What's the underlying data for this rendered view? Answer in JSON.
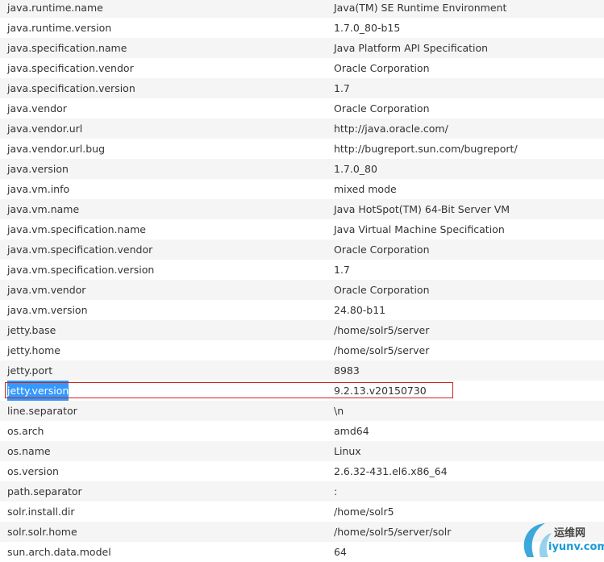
{
  "properties": [
    {
      "key": "java.runtime.name",
      "value": "Java(TM) SE Runtime Environment"
    },
    {
      "key": "java.runtime.version",
      "value": "1.7.0_80-b15"
    },
    {
      "key": "java.specification.name",
      "value": "Java Platform API Specification"
    },
    {
      "key": "java.specification.vendor",
      "value": "Oracle Corporation"
    },
    {
      "key": "java.specification.version",
      "value": "1.7"
    },
    {
      "key": "java.vendor",
      "value": "Oracle Corporation"
    },
    {
      "key": "java.vendor.url",
      "value": "http://java.oracle.com/"
    },
    {
      "key": "java.vendor.url.bug",
      "value": "http://bugreport.sun.com/bugreport/"
    },
    {
      "key": "java.version",
      "value": "1.7.0_80"
    },
    {
      "key": "java.vm.info",
      "value": "mixed mode"
    },
    {
      "key": "java.vm.name",
      "value": "Java HotSpot(TM) 64-Bit Server VM"
    },
    {
      "key": "java.vm.specification.name",
      "value": "Java Virtual Machine Specification"
    },
    {
      "key": "java.vm.specification.vendor",
      "value": "Oracle Corporation"
    },
    {
      "key": "java.vm.specification.version",
      "value": "1.7"
    },
    {
      "key": "java.vm.vendor",
      "value": "Oracle Corporation"
    },
    {
      "key": "java.vm.version",
      "value": "24.80-b11"
    },
    {
      "key": "jetty.base",
      "value": "/home/solr5/server"
    },
    {
      "key": "jetty.home",
      "value": "/home/solr5/server"
    },
    {
      "key": "jetty.port",
      "value": "8983"
    },
    {
      "key": "jetty.version",
      "value": "9.2.13.v20150730"
    },
    {
      "key": "line.separator",
      "value": "\\n"
    },
    {
      "key": "os.arch",
      "value": "amd64"
    },
    {
      "key": "os.name",
      "value": "Linux"
    },
    {
      "key": "os.version",
      "value": "2.6.32-431.el6.x86_64"
    },
    {
      "key": "path.separator",
      "value": ":"
    },
    {
      "key": "solr.install.dir",
      "value": "/home/solr5"
    },
    {
      "key": "solr.solr.home",
      "value": "/home/solr5/server/solr"
    },
    {
      "key": "sun.arch.data.model",
      "value": "64"
    }
  ],
  "highlighted_key": "jetty.version",
  "colors": {
    "selection": "#3399ff",
    "highlight_border": "#cc2222",
    "stripe": "#f5f5f5",
    "watermark_blue": "#1a9ad6"
  },
  "watermark": {
    "line1": "运维网",
    "line2": "iyunv.com"
  }
}
